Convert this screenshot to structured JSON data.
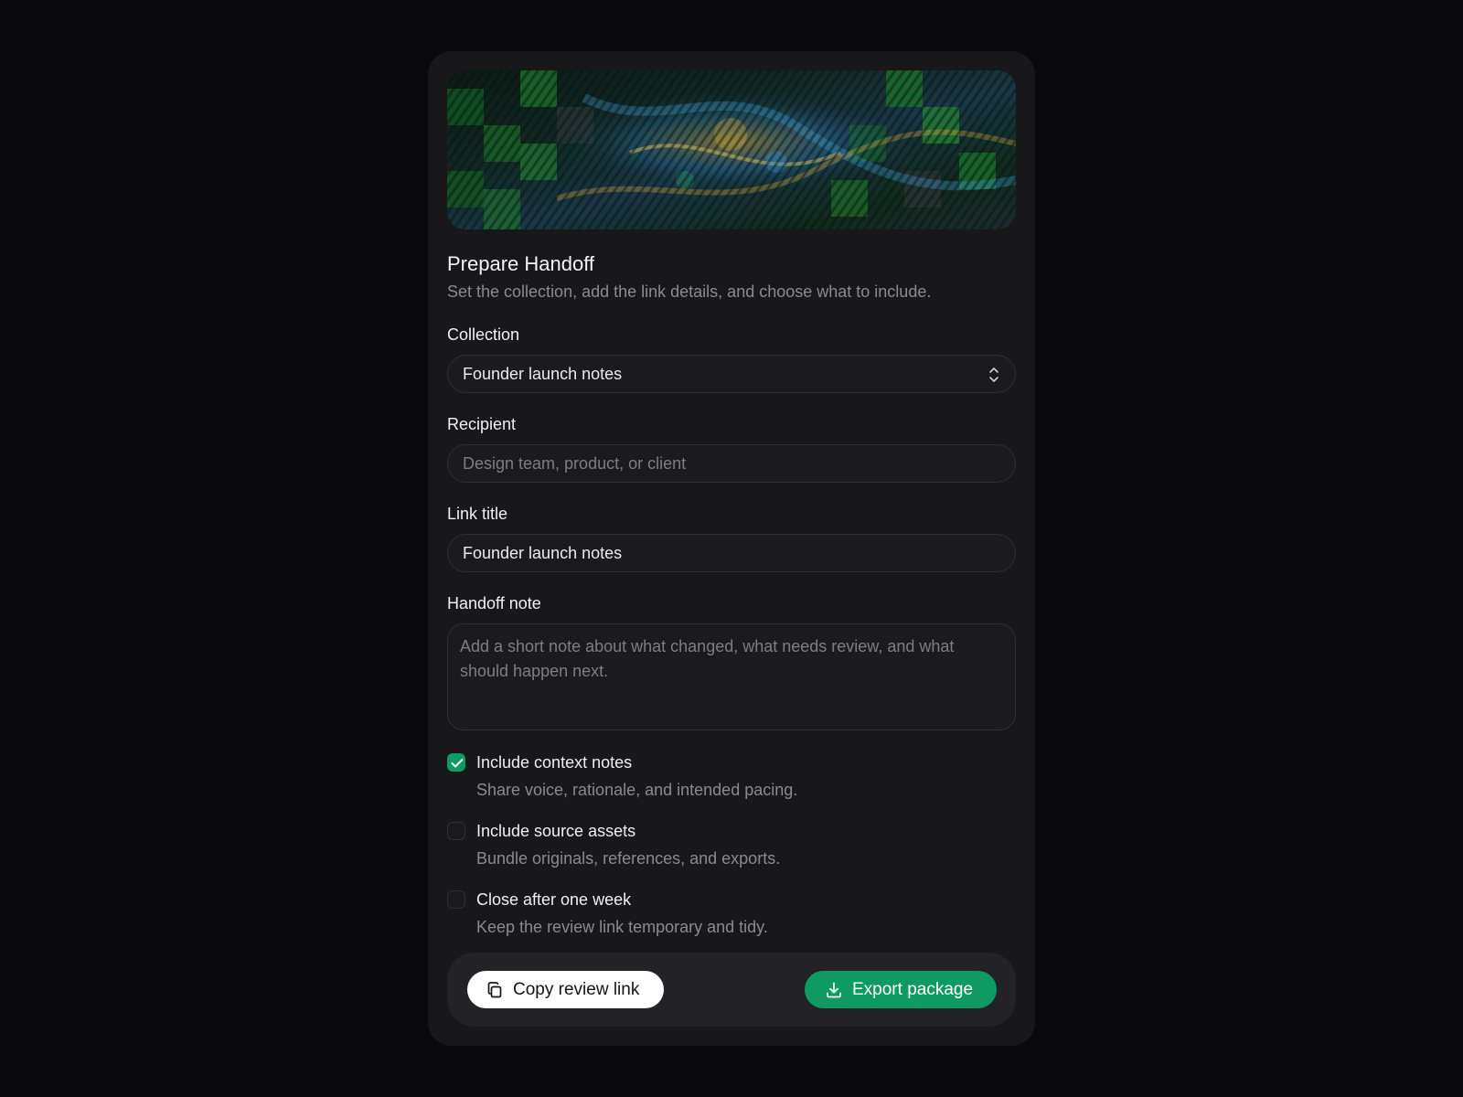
{
  "dialog": {
    "title": "Prepare Handoff",
    "subtitle": "Set the collection, add the link details, and choose what to include."
  },
  "fields": {
    "collection": {
      "label": "Collection",
      "value": "Founder launch notes"
    },
    "recipient": {
      "label": "Recipient",
      "placeholder": "Design team, product, or client",
      "value": ""
    },
    "link_title": {
      "label": "Link title",
      "value": "Founder launch notes"
    },
    "handoff_note": {
      "label": "Handoff note",
      "placeholder": "Add a short note about what changed, what needs review, and what should happen next.",
      "value": ""
    }
  },
  "options": [
    {
      "title": "Include context notes",
      "description": "Share voice, rationale, and intended pacing.",
      "checked": true
    },
    {
      "title": "Include source assets",
      "description": "Bundle originals, references, and exports.",
      "checked": false
    },
    {
      "title": "Close after one week",
      "description": "Keep the review link temporary and tidy.",
      "checked": false
    }
  ],
  "actions": {
    "copy_label": "Copy review link",
    "copy_icon": "copy-icon",
    "export_label": "Export package",
    "export_icon": "download-icon"
  },
  "colors": {
    "accent": "#0f9a64",
    "card_bg": "#18181b",
    "page_bg": "#0a0a0c"
  }
}
